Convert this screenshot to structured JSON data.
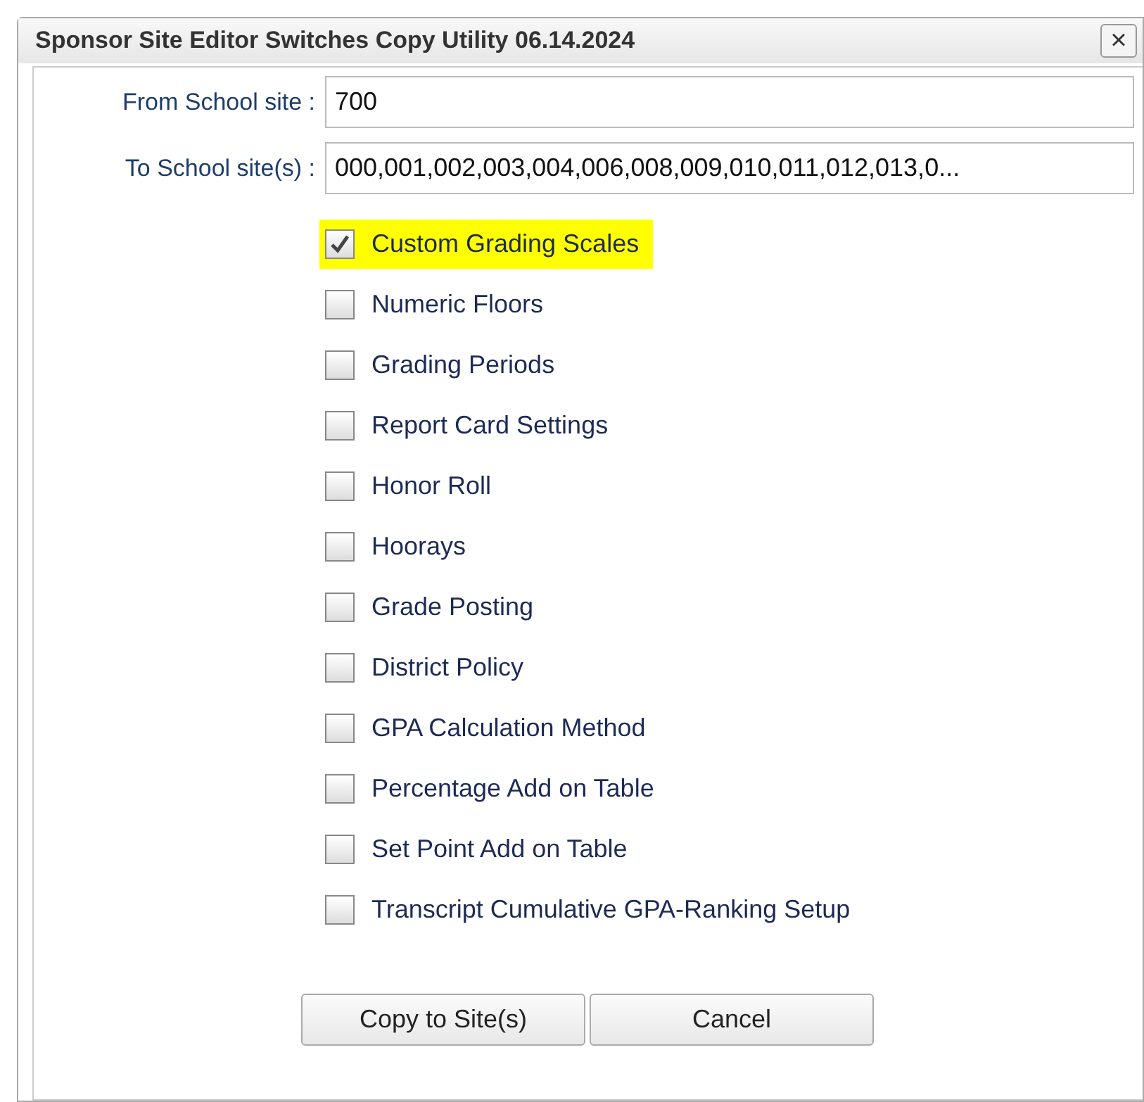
{
  "window": {
    "title": "Sponsor Site Editor Switches Copy Utility 06.14.2024",
    "close": "×"
  },
  "fields": [
    {
      "label": "From School site :",
      "value": "700"
    },
    {
      "label": "To School site(s) :",
      "value": "000,001,002,003,004,006,008,009,010,011,012,013,0..."
    }
  ],
  "options": [
    {
      "label": "Custom Grading Scales",
      "checked": true,
      "highlighted": true
    },
    {
      "label": "Numeric Floors",
      "checked": false,
      "highlighted": false
    },
    {
      "label": "Grading Periods",
      "checked": false,
      "highlighted": false
    },
    {
      "label": "Report Card Settings",
      "checked": false,
      "highlighted": false
    },
    {
      "label": "Honor Roll",
      "checked": false,
      "highlighted": false
    },
    {
      "label": "Hoorays",
      "checked": false,
      "highlighted": false
    },
    {
      "label": "Grade Posting",
      "checked": false,
      "highlighted": false
    },
    {
      "label": "District Policy",
      "checked": false,
      "highlighted": false
    },
    {
      "label": "GPA Calculation Method",
      "checked": false,
      "highlighted": false
    },
    {
      "label": "Percentage Add on Table",
      "checked": false,
      "highlighted": false
    },
    {
      "label": "Set Point Add on Table",
      "checked": false,
      "highlighted": false
    },
    {
      "label": "Transcript Cumulative GPA-Ranking Setup",
      "checked": false,
      "highlighted": false
    }
  ],
  "buttons": [
    "Copy to Site(s)",
    "Cancel"
  ]
}
